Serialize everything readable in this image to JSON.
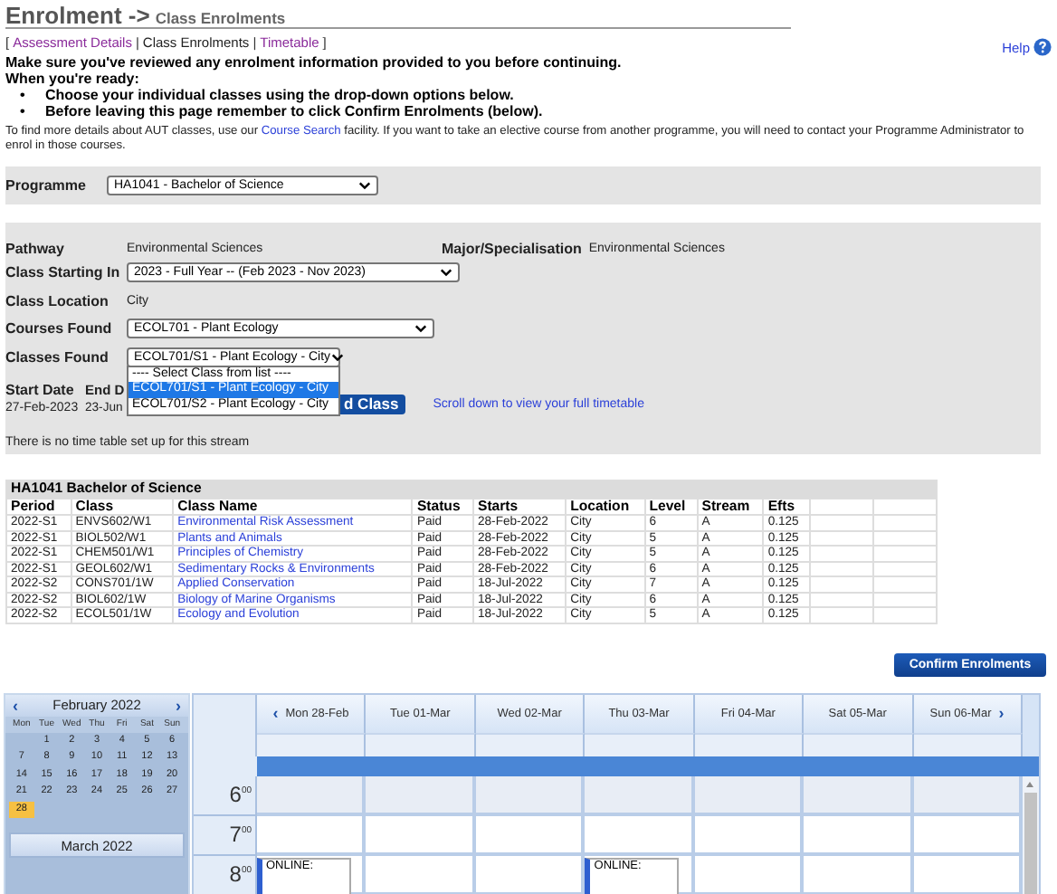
{
  "header": {
    "title": "Enrolment ->",
    "subtitle": "Class Enrolments"
  },
  "nav": [
    {
      "kind": "punct",
      "label": "["
    },
    {
      "kind": "link",
      "label": "Assessment Details",
      "selected": false
    },
    {
      "kind": "punct",
      "label": "|"
    },
    {
      "kind": "link",
      "label": "Class Enrolments",
      "selected": true
    },
    {
      "kind": "punct",
      "label": "|"
    },
    {
      "kind": "link",
      "label": "Timetable",
      "selected": false
    },
    {
      "kind": "punct",
      "label": "]"
    }
  ],
  "help": {
    "label": "Help"
  },
  "instructions": {
    "lines": [
      "Make sure you've reviewed any enrolment information provided to you before continuing.",
      "When you're ready:"
    ],
    "bullets": [
      {
        "marker": "•",
        "text": "Choose your individual classes using the drop-down options below."
      },
      {
        "marker": "•",
        "text": "Before leaving this page remember to click Confirm Enrolments (below)."
      }
    ]
  },
  "info": {
    "before": "To find more details about AUT classes, use our",
    "link": "Course Search",
    "after": "facility. If you want to take an elective course from another programme, you will need to contact your Programme Administrator to enrol in those courses."
  },
  "programme": {
    "label": "Programme",
    "value": "HA1041 - Bachelor of Science"
  },
  "pathway": {
    "label": "Pathway",
    "value": "Environmental Sciences"
  },
  "major": {
    "label": "Major/Specialisation",
    "value": "Environmental Sciences"
  },
  "class_starting": {
    "label": "Class Starting In",
    "value": "2023 - Full Year -- (Feb 2023 - Nov 2023)"
  },
  "class_location": {
    "label": "Class Location",
    "value": "City"
  },
  "courses_found": {
    "label": "Courses Found",
    "value": "ECOL701 - Plant Ecology"
  },
  "classes_found": {
    "label": "Classes Found",
    "value": "ECOL701/S1 - Plant Ecology - City",
    "expanded": true,
    "options": [
      {
        "label": "---- Select Class from list ----",
        "selected": false
      },
      {
        "label": "ECOL701/S1 - Plant Ecology - City",
        "selected": true
      },
      {
        "label": "ECOL701/S2 - Plant Ecology - City",
        "selected": false
      }
    ]
  },
  "dates": {
    "start_label": "Start Date",
    "start_value": "27-Feb-2023",
    "end_label": "End D",
    "end_value": "23-Jun"
  },
  "add_class_button": "d Class",
  "scroll_link": "Scroll down to view your full timetable",
  "no_timetable_note": "There is no time table set up for this stream",
  "table": {
    "title": "HA1041 Bachelor of Science",
    "columns": [
      "Period",
      "Class",
      "Class Name",
      "Status",
      "Starts",
      "Location",
      "Level",
      "Stream",
      "Efts"
    ],
    "rows": [
      [
        "2022-S1",
        "ENVS602/W1",
        "Environmental Risk Assessment",
        "Paid",
        "28-Feb-2022",
        "City",
        "6",
        "A",
        "0.125"
      ],
      [
        "2022-S1",
        "BIOL502/W1",
        "Plants and Animals",
        "Paid",
        "28-Feb-2022",
        "City",
        "5",
        "A",
        "0.125"
      ],
      [
        "2022-S1",
        "CHEM501/W1",
        "Principles of Chemistry",
        "Paid",
        "28-Feb-2022",
        "City",
        "5",
        "A",
        "0.125"
      ],
      [
        "2022-S1",
        "GEOL602/W1",
        "Sedimentary Rocks & Environments",
        "Paid",
        "28-Feb-2022",
        "City",
        "6",
        "A",
        "0.125"
      ],
      [
        "2022-S2",
        "CONS701/1W",
        "Applied Conservation",
        "Paid",
        "18-Jul-2022",
        "City",
        "7",
        "A",
        "0.125"
      ],
      [
        "2022-S2",
        "BIOL602/1W",
        "Biology of Marine Organisms",
        "Paid",
        "18-Jul-2022",
        "City",
        "6",
        "A",
        "0.125"
      ],
      [
        "2022-S2",
        "ECOL501/1W",
        "Ecology and Evolution",
        "Paid",
        "18-Jul-2022",
        "City",
        "5",
        "A",
        "0.125"
      ]
    ]
  },
  "confirm_button": "Confirm Enrolments",
  "mini_calendar": {
    "prev": "‹",
    "month": "February 2022",
    "next": "›",
    "weekdays": [
      "Mon",
      "Tue",
      "Wed",
      "Thu",
      "Fri",
      "Sat",
      "Sun"
    ],
    "weeks": [
      [
        {
          "label": "1",
          "selected": false
        },
        {
          "label": "2",
          "selected": false
        },
        {
          "label": "3",
          "selected": false
        },
        {
          "label": "4",
          "selected": false
        },
        {
          "label": "5",
          "selected": false
        },
        {
          "label": "6",
          "selected": false
        }
      ],
      [
        {
          "label": "7",
          "selected": false
        },
        {
          "label": "8",
          "selected": false
        },
        {
          "label": "9",
          "selected": false
        },
        {
          "label": "10",
          "selected": false
        },
        {
          "label": "11",
          "selected": false
        },
        {
          "label": "12",
          "selected": false
        },
        {
          "label": "13",
          "selected": false
        }
      ],
      [
        {
          "label": "14",
          "selected": false
        },
        {
          "label": "15",
          "selected": false
        },
        {
          "label": "16",
          "selected": false
        },
        {
          "label": "17",
          "selected": false
        },
        {
          "label": "18",
          "selected": false
        },
        {
          "label": "19",
          "selected": false
        },
        {
          "label": "20",
          "selected": false
        }
      ],
      [
        {
          "label": "21",
          "selected": false
        },
        {
          "label": "22",
          "selected": false
        },
        {
          "label": "23",
          "selected": false
        },
        {
          "label": "24",
          "selected": false
        },
        {
          "label": "25",
          "selected": false
        },
        {
          "label": "26",
          "selected": false
        },
        {
          "label": "27",
          "selected": false
        }
      ],
      [
        {
          "label": "28",
          "selected": true
        }
      ]
    ],
    "next_month": "March 2022"
  },
  "scheduler": {
    "prev": "‹",
    "next": "›",
    "days": [
      {
        "label": "Mon 28-Feb",
        "events": [
          {
            "title": "ONLINE:"
          }
        ]
      },
      {
        "label": "Tue 01-Mar"
      },
      {
        "label": "Wed 02-Mar"
      },
      {
        "label": "Thu 03-Mar",
        "events": [
          {
            "title": "ONLINE:"
          }
        ]
      },
      {
        "label": "Fri 04-Mar"
      },
      {
        "label": "Sat 05-Mar"
      },
      {
        "label": "Sun 06-Mar"
      }
    ],
    "hours": [
      {
        "hour": "6",
        "minutes": "00"
      },
      {
        "hour": "7",
        "minutes": "00"
      },
      {
        "hour": "8",
        "minutes": "00"
      }
    ]
  }
}
